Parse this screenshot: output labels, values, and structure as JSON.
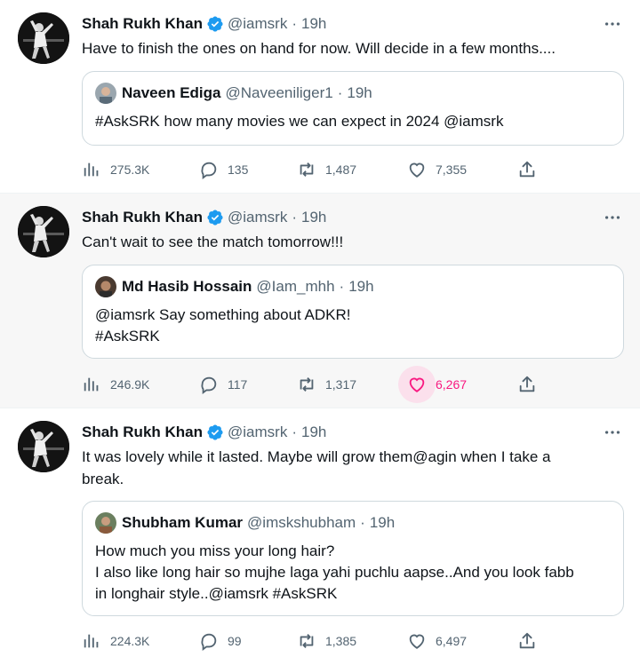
{
  "tweets": [
    {
      "author_name": "Shah Rukh Khan",
      "author_handle": "@iamsrk",
      "separator": "·",
      "time": "19h",
      "text": "Have to finish the ones on hand for now. Will decide in a few months....",
      "quote": {
        "author_name": "Naveen Ediga",
        "author_handle": "@Naveeniliger1",
        "time": "19h",
        "lines": [
          "#AskSRK how many movies we can expect in 2024 @iamsrk"
        ]
      },
      "stats": {
        "views": "275.3K",
        "replies": "135",
        "retweets": "1,487",
        "likes": "7,355"
      },
      "liked": false
    },
    {
      "author_name": "Shah Rukh Khan",
      "author_handle": "@iamsrk",
      "separator": "·",
      "time": "19h",
      "text": "Can't wait to see the match tomorrow!!!",
      "quote": {
        "author_name": "Md Hasib Hossain",
        "author_handle": "@Iam_mhh",
        "time": "19h",
        "lines": [
          "@iamsrk Say something about ADKR!",
          "#AskSRK"
        ]
      },
      "stats": {
        "views": "246.9K",
        "replies": "117",
        "retweets": "1,317",
        "likes": "6,267"
      },
      "liked": true
    },
    {
      "author_name": "Shah Rukh Khan",
      "author_handle": "@iamsrk",
      "separator": "·",
      "time": "19h",
      "text_lines": [
        "It was lovely while it lasted. Maybe will grow them@agin when I take a",
        "break."
      ],
      "quote": {
        "author_name": "Shubham Kumar",
        "author_handle": "@imskshubham",
        "time": "19h",
        "lines": [
          "How much you miss your long hair?",
          "I also like long hair so mujhe laga yahi puchlu aapse..And you look fabb",
          "in longhair style..@iamsrk #AskSRK"
        ]
      },
      "stats": {
        "views": "224.3K",
        "replies": "99",
        "retweets": "1,385",
        "likes": "6,497"
      },
      "liked": false
    }
  ],
  "icons": {
    "views": "bar-chart-icon",
    "reply": "speech-bubble-icon",
    "retweet": "retweet-icon",
    "like": "heart-icon",
    "share": "share-icon",
    "more": "more-dots-icon",
    "verified": "verified-badge-icon"
  },
  "colors": {
    "text": "#0f1419",
    "secondary": "#536471",
    "verified": "#1d9bf0",
    "like_active": "#f91880",
    "like_active_bg": "#fbe0ec",
    "highlight_bg": "#f7f7f7"
  }
}
